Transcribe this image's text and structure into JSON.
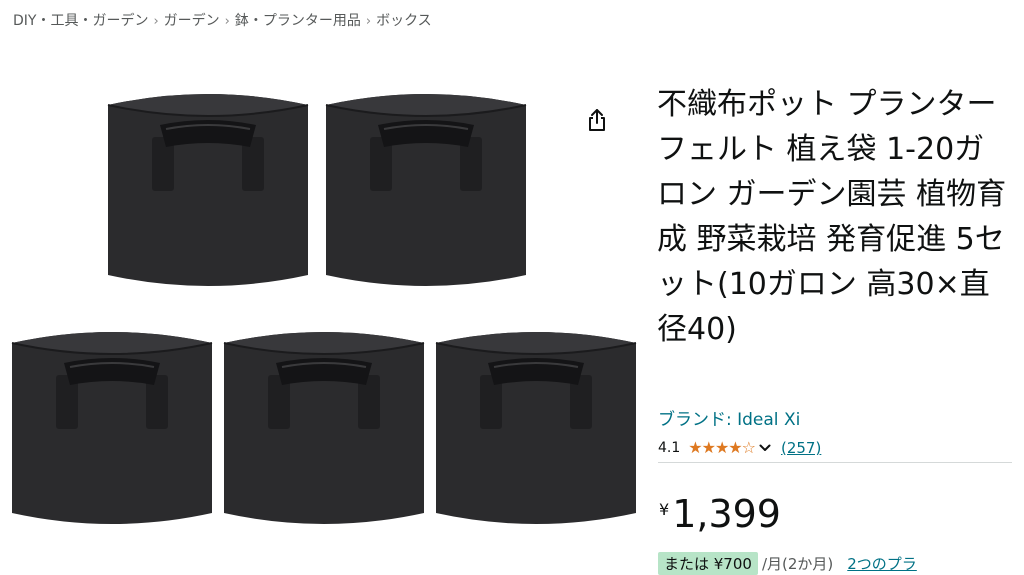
{
  "breadcrumb": {
    "items": [
      "DIY・工具・ガーデン",
      "ガーデン",
      "鉢・プランター用品",
      "ボックス"
    ],
    "separator": "›"
  },
  "product": {
    "title": "不織布ポット プランター フェルト 植え袋 1-20ガロン ガーデン園芸 植物育成 野菜栽培 発育促進 5セット(10ガロン 高30×直径40)",
    "brand_label": "ブランド: Ideal Xi",
    "rating_value": "4.1",
    "rating_stars": 4.1,
    "star_glyphs": [
      "★",
      "★",
      "★",
      "★",
      "☆"
    ],
    "review_count": "(257)",
    "currency_symbol": "¥",
    "price": "1,399",
    "promo_badge": "または ¥700",
    "promo_unit": "/月(2か月)",
    "promo_link": "2つのプラ"
  },
  "icons": {
    "share": "share-icon",
    "chevron": "chevron-down-icon"
  },
  "colors": {
    "link": "#007185",
    "star": "#de7921",
    "text": "#0f1111",
    "muted": "#565959",
    "pot_body": "#2b2b2d",
    "promo_bg": "#b7e4c7"
  }
}
